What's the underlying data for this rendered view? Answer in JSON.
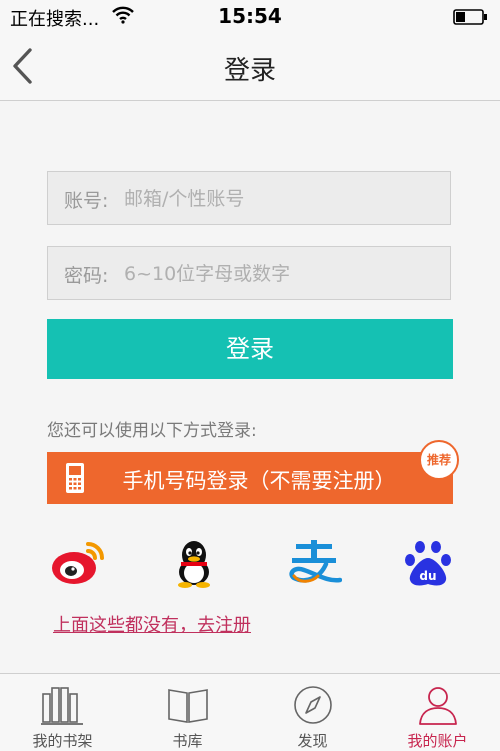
{
  "status_bar": {
    "carrier": "正在搜索...",
    "time": "15:54"
  },
  "nav": {
    "title": "登录"
  },
  "form": {
    "account_label": "账号:",
    "account_placeholder": "邮箱/个性账号",
    "password_label": "密码:",
    "password_placeholder": "6~10位字母或数字",
    "login_button": "登录"
  },
  "alt_login": {
    "prompt": "您还可以使用以下方式登录:",
    "phone_button": "手机号码登录（不需要注册）",
    "recommend_badge": "推荐",
    "providers": [
      "weibo-icon",
      "qq-icon",
      "alipay-icon",
      "baidu-icon"
    ]
  },
  "register_link": "上面这些都没有，去注册",
  "tabbar": {
    "items": [
      {
        "label": "我的书架",
        "icon": "bookshelf-icon"
      },
      {
        "label": "书库",
        "icon": "book-icon"
      },
      {
        "label": "发现",
        "icon": "compass-icon"
      },
      {
        "label": "我的账户",
        "icon": "user-icon"
      }
    ],
    "active_index": 3
  },
  "colors": {
    "accent_teal": "#15c1b3",
    "accent_orange": "#ee672d",
    "accent_pink": "#c7254e"
  }
}
